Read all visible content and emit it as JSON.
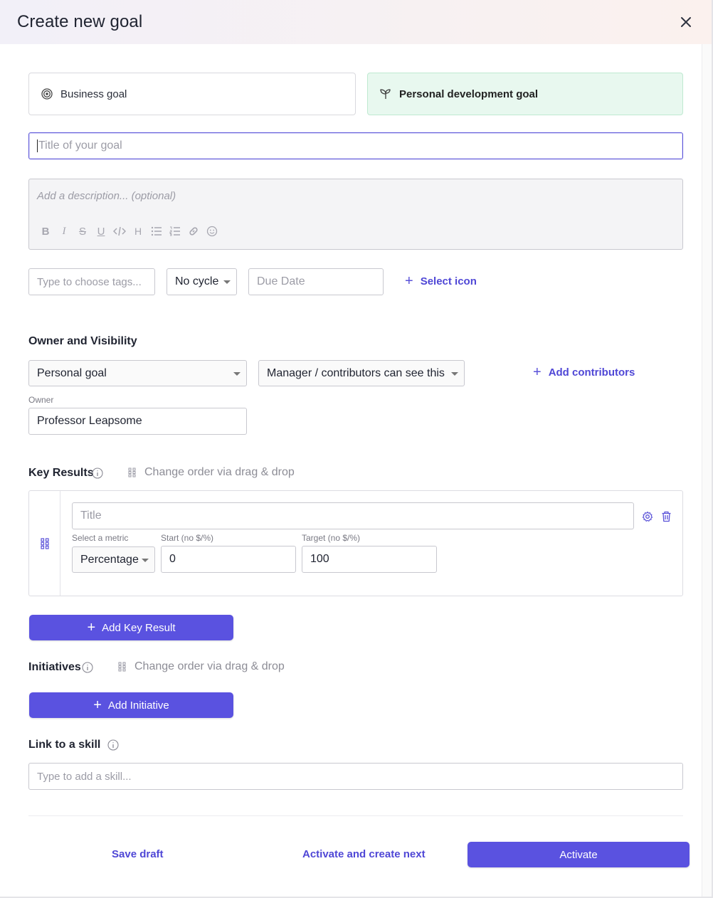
{
  "header": {
    "title": "Create new goal"
  },
  "goal_types": {
    "business": "Business goal",
    "personal": "Personal development goal"
  },
  "title_input": {
    "placeholder": "Title of your goal"
  },
  "description": {
    "placeholder": "Add a description... (optional)"
  },
  "meta_row": {
    "tags_placeholder": "Type to choose tags...",
    "cycle_value": "No cycle",
    "due_date_placeholder": "Due Date",
    "select_icon": "Select icon"
  },
  "owner_visibility": {
    "heading": "Owner and Visibility",
    "goal_scope": "Personal goal",
    "visibility": "Manager / contributors can see this",
    "add_contributors": "Add contributors",
    "owner_label": "Owner",
    "owner_value": "Professor Leapsome"
  },
  "key_results": {
    "heading": "Key Results",
    "drag_hint": "Change order via drag & drop",
    "title_placeholder": "Title",
    "metric_label": "Select a metric",
    "metric_value": "Percentage",
    "start_label": "Start (no $/%)",
    "start_value": "0",
    "target_label": "Target (no $/%)",
    "target_value": "100",
    "add_button": "Add Key Result"
  },
  "initiatives": {
    "heading": "Initiatives",
    "drag_hint": "Change order via drag & drop",
    "add_button": "Add Initiative"
  },
  "skill": {
    "heading": "Link to a skill",
    "placeholder": "Type to add a skill..."
  },
  "footer": {
    "save_draft": "Save draft",
    "activate_next": "Activate and create next",
    "activate": "Activate"
  },
  "colors": {
    "accent": "#5a52e0",
    "personal_bg": "#e8f8ef",
    "link": "#4f47d6"
  },
  "icons": {
    "close": "close-icon",
    "business": "target-icon",
    "personal": "sprout-icon",
    "info": "info-icon",
    "drag": "drag-dots-icon",
    "settings": "gear-icon",
    "delete": "trash-icon"
  }
}
